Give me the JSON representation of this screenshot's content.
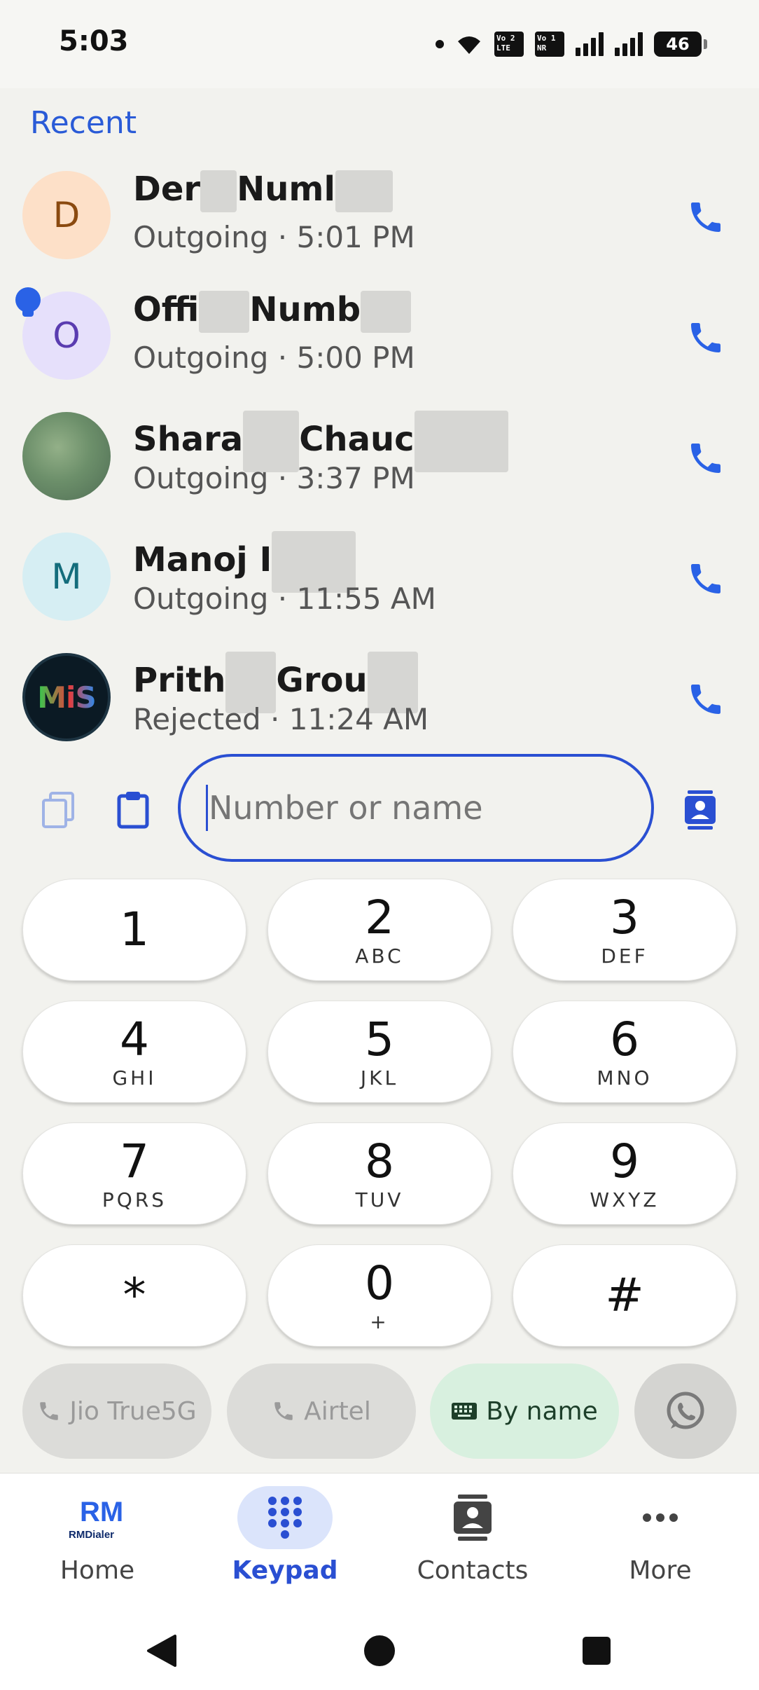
{
  "status_bar": {
    "time": "5:03",
    "volte1": "Vo 2 LTE",
    "volte2": "Vo 1 NR",
    "battery": "46"
  },
  "recent": {
    "title": "Recent",
    "items": [
      {
        "initial": "D",
        "name_a": "Der",
        "name_b": "Numl",
        "meta": "Outgoing · 5:01 PM",
        "avatar": "initial-orange"
      },
      {
        "initial": "O",
        "name_a": "Offi",
        "name_b": "Numb",
        "meta": "Outgoing · 5:00 PM",
        "avatar": "initial-purple",
        "pinned": true
      },
      {
        "initial": "",
        "name_a": "Shara",
        "name_b": "Chauc",
        "meta": "Outgoing · 3:37 PM",
        "avatar": "photo"
      },
      {
        "initial": "M",
        "name_a": "Manoj I",
        "name_b": "",
        "meta": "Outgoing · 11:55 AM",
        "avatar": "initial-teal"
      },
      {
        "initial": "MiS",
        "name_a": "Prith",
        "name_b": "Grou",
        "meta": "Rejected · 11:24 AM",
        "avatar": "logo"
      }
    ]
  },
  "dial": {
    "placeholder": "Number or name",
    "copy_icon": "copy-icon",
    "paste_icon": "clipboard-icon",
    "contact_icon": "contact-card-icon"
  },
  "keypad": [
    {
      "digit": "1",
      "letters": ""
    },
    {
      "digit": "2",
      "letters": "ABC"
    },
    {
      "digit": "3",
      "letters": "DEF"
    },
    {
      "digit": "4",
      "letters": "GHI"
    },
    {
      "digit": "5",
      "letters": "JKL"
    },
    {
      "digit": "6",
      "letters": "MNO"
    },
    {
      "digit": "7",
      "letters": "PQRS"
    },
    {
      "digit": "8",
      "letters": "TUV"
    },
    {
      "digit": "9",
      "letters": "WXYZ"
    },
    {
      "digit": "*",
      "letters": ""
    },
    {
      "digit": "0",
      "letters": "+"
    },
    {
      "digit": "#",
      "letters": ""
    }
  ],
  "sim_options": {
    "sim1": "Jio True5G",
    "sim2": "Airtel",
    "by_name": "By name"
  },
  "bottom_nav": {
    "home_logo": "RMDialer",
    "home": "Home",
    "keypad": "Keypad",
    "contacts": "Contacts",
    "more": "More"
  },
  "colors": {
    "accent": "#2a4fd2",
    "call_icon": "#2a62e6",
    "background": "#f2f2ee"
  }
}
